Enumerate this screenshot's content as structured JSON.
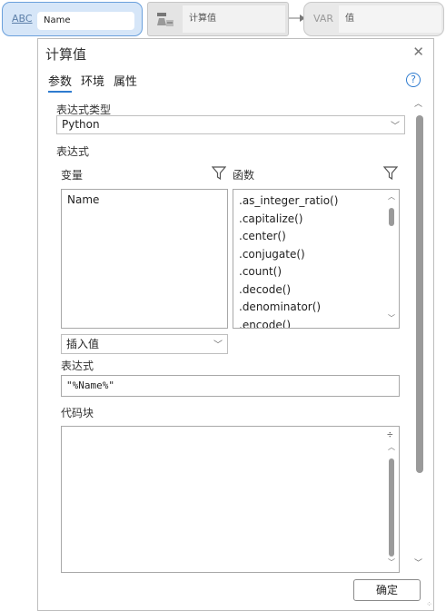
{
  "model": {
    "input_node": {
      "type_label": "ABC",
      "value": "Name"
    },
    "tool_node": {
      "value": "计算值",
      "icon": "calculate-tool-icon"
    },
    "output_node": {
      "type_label": "VAR",
      "value": "值"
    }
  },
  "dialog": {
    "title": "计算值",
    "tabs": [
      {
        "label": "参数",
        "active": true
      },
      {
        "label": "环境",
        "active": false
      },
      {
        "label": "属性",
        "active": false
      }
    ],
    "expression_type": {
      "label": "表达式类型",
      "value": "Python"
    },
    "expression_section_label": "表达式",
    "variables": {
      "label": "变量",
      "items": [
        "Name"
      ]
    },
    "functions": {
      "label": "函数",
      "items": [
        ".as_integer_ratio()",
        ".capitalize()",
        ".center()",
        ".conjugate()",
        ".count()",
        ".decode()",
        ".denominator()",
        ".encode()"
      ]
    },
    "insert_value": {
      "value": "插入值"
    },
    "expression": {
      "label": "表达式",
      "value": "\"%Name%\""
    },
    "code_block": {
      "label": "代码块",
      "value": ""
    },
    "ok_label": "确定"
  }
}
